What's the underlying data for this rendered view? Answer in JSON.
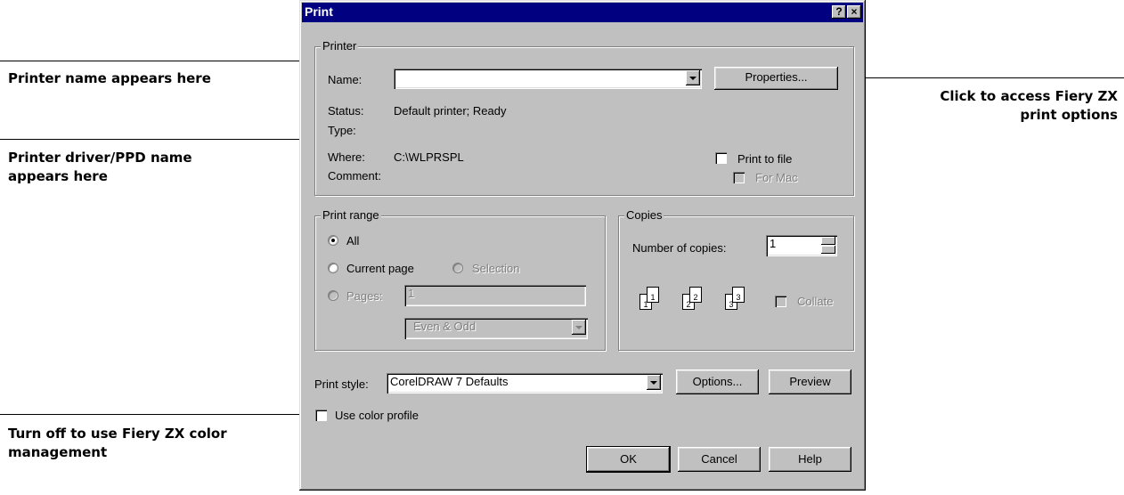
{
  "callouts": {
    "printer_name": "Printer name appears here",
    "driver_name_1": "Printer driver/PPD name",
    "driver_name_2": "appears here",
    "color_1": "Turn off to use Fiery ZX color",
    "color_2": "management",
    "access_1": "Click to access Fiery ZX",
    "access_2": "print options"
  },
  "dialog": {
    "title": "Print",
    "help_btn": "?",
    "close_btn": "×",
    "printer_group": "Printer",
    "name_label": "Name:",
    "name_value": "",
    "properties_btn": "Properties...",
    "status_label": "Status:",
    "status_value": "Default printer; Ready",
    "type_label": "Type:",
    "where_label": "Where:",
    "where_value": "C:\\WLPRSPL",
    "comment_label": "Comment:",
    "print_to_file": "Print to file",
    "for_mac": "For Mac",
    "range_group": "Print range",
    "all_label": "All",
    "current_page": "Current page",
    "selection": "Selection",
    "pages": "Pages:",
    "pages_value": "1",
    "even_odd": "Even & Odd",
    "copies_group": "Copies",
    "number_of_copies": "Number of copies:",
    "copies_value": "1",
    "collate": "Collate",
    "page_1": "1",
    "page_2": "2",
    "page_3": "3",
    "print_style_label": "Print style:",
    "print_style_value": "CorelDRAW 7 Defaults",
    "options_btn": "Options...",
    "preview_btn": "Preview",
    "use_color_profile": "Use color profile",
    "ok_btn": "OK",
    "cancel_btn": "Cancel",
    "help_btn2": "Help"
  }
}
